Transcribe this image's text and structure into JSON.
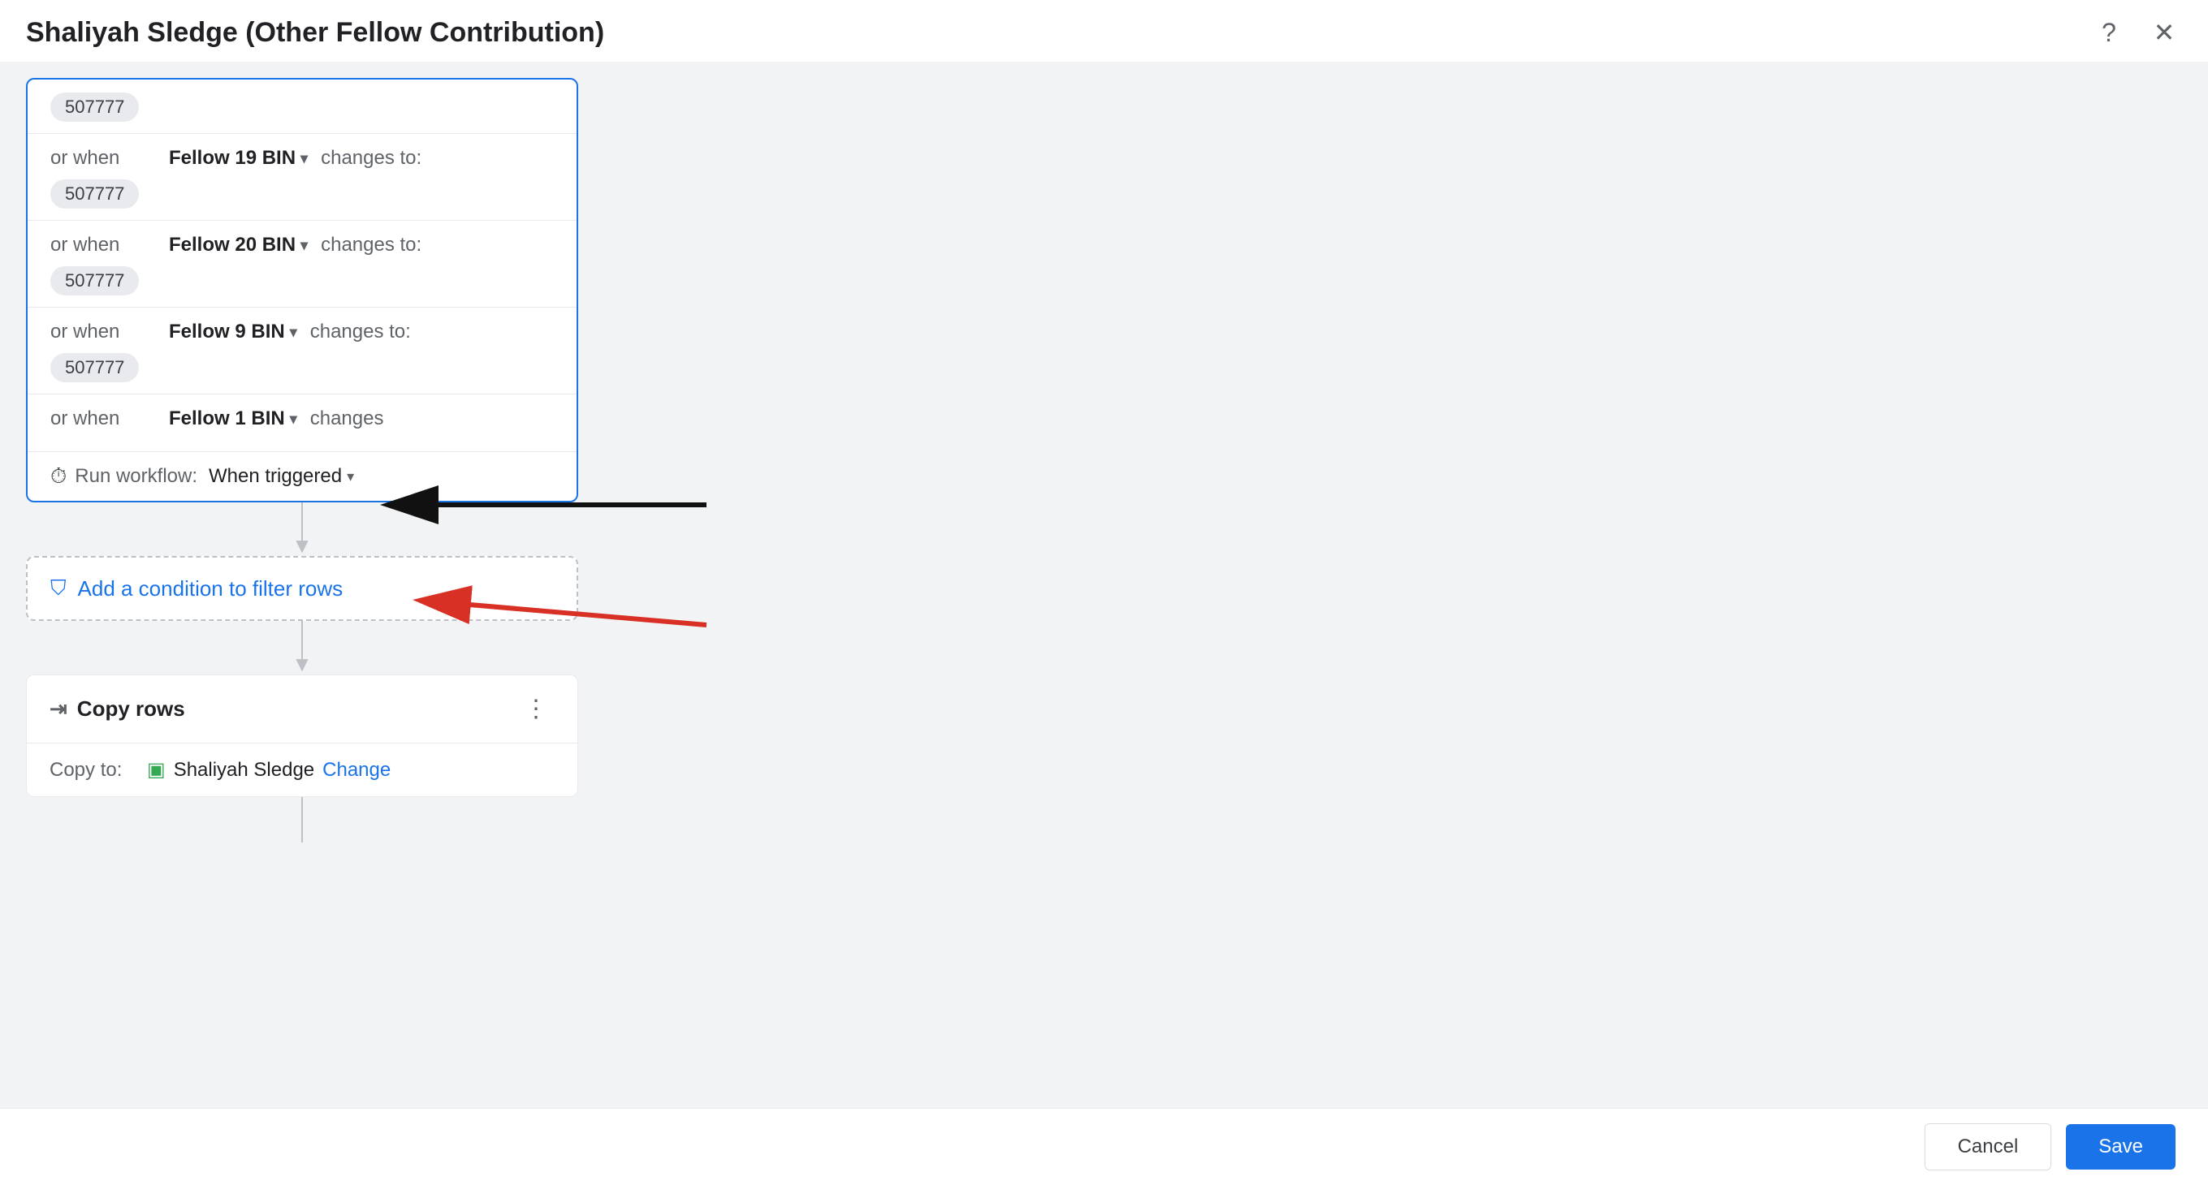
{
  "header": {
    "title": "Shaliyah Sledge (Other Fellow Contribution)",
    "help_icon": "?",
    "close_icon": "✕"
  },
  "workflow_block": {
    "scrolled_top": {
      "value": "507777"
    },
    "conditions": [
      {
        "id": "cond1",
        "or_when": "or when",
        "field": "Fellow 19 BIN",
        "changes_to": "changes to:",
        "values": [
          "507777"
        ]
      },
      {
        "id": "cond2",
        "or_when": "or when",
        "field": "Fellow 20 BIN",
        "changes_to": "changes to:",
        "values": [
          "507777"
        ]
      },
      {
        "id": "cond3",
        "or_when": "or when",
        "field": "Fellow 9 BIN",
        "changes_to": "changes to:",
        "values": [
          "507777"
        ]
      },
      {
        "id": "cond4",
        "or_when": "or when",
        "field": "Fellow 1 BIN",
        "changes_to": "changes",
        "values": []
      }
    ],
    "run_workflow": {
      "label": "Run workflow:",
      "value": "When triggered"
    }
  },
  "add_condition": {
    "text": "Add a condition to filter rows"
  },
  "copy_rows": {
    "title": "Copy rows",
    "copy_to_label": "Copy to:",
    "sheet_name": "Shaliyah Sledge",
    "change_label": "Change"
  },
  "footer": {
    "cancel_label": "Cancel",
    "save_label": "Save"
  }
}
